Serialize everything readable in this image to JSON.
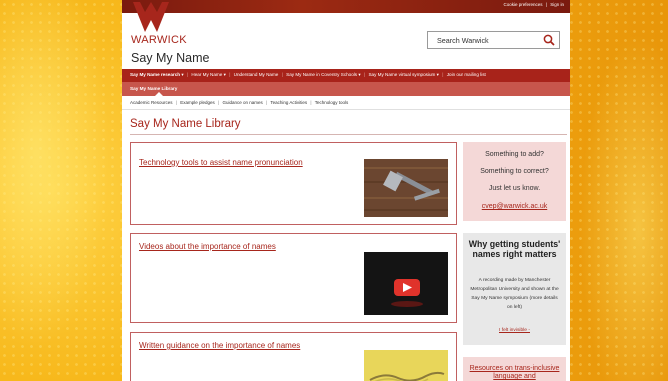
{
  "top_bar": {
    "cookie_label": "Cookie preferences",
    "separator": "|",
    "sign_in_label": "Sign in"
  },
  "brand": {
    "logo_text": "WARWICK",
    "site_title": "Say My Name"
  },
  "search": {
    "placeholder": "Search Warwick"
  },
  "main_nav": {
    "items": [
      "Say My Name research",
      "Hear My Name",
      "Understand My Name",
      "Say My Name in Coventry Schools",
      "Say My Name virtual symposium",
      "Join our mailing list"
    ],
    "separator": "|"
  },
  "sub_nav": {
    "active_label": "Say My Name Library"
  },
  "breadcrumb": {
    "items": [
      "Academic Resources",
      "Example pledges",
      "Guidance on names",
      "Teaching Activities",
      "Technology tools"
    ],
    "separator": "|"
  },
  "main": {
    "heading": "Say My Name Library",
    "cards": [
      {
        "title": "Technology tools to assist name pronunciation",
        "image": "tools-photo"
      },
      {
        "title": "Videos about the importance of names",
        "image": "video-play-icon"
      },
      {
        "title": "Written guidance on the importance of names",
        "image": "paperclip-chain-photo"
      }
    ]
  },
  "sidebar": {
    "box1": {
      "line1": "Something to add?",
      "line2": "Something to correct?",
      "line3": "Just let us know.",
      "email": "cvep@warwick.ac.uk"
    },
    "box2": {
      "heading": "Why getting students' names right matters",
      "body": "A recording made by Manchester Metropolitan University and shown at the Say My Name symposium (more details on left)",
      "link": "I felt invisible -"
    },
    "box3": {
      "link": "Resources on trans-inclusive language and"
    }
  },
  "colors": {
    "brand_red": "#a7261c",
    "nav_red": "#a8231a",
    "subnav_red": "#c7564c",
    "sidebar_pink": "#f4d8d7",
    "sidebar_grey": "#e8e8e8",
    "background_yellow": "#f7b81b"
  }
}
